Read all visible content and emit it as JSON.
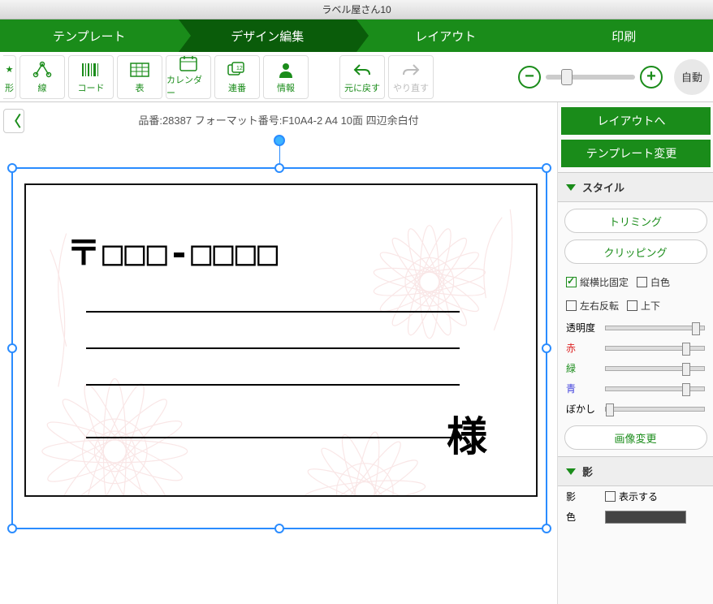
{
  "app_title": "ラベル屋さん10",
  "nav": {
    "tabs": [
      "テンプレート",
      "デザイン編集",
      "レイアウト",
      "印刷"
    ],
    "active_index": 1
  },
  "toolbar": {
    "items": [
      {
        "id": "shape",
        "label": "形",
        "icon": "star"
      },
      {
        "id": "line",
        "label": "線",
        "icon": "line"
      },
      {
        "id": "code",
        "label": "コード",
        "icon": "barcode"
      },
      {
        "id": "table",
        "label": "表",
        "icon": "table"
      },
      {
        "id": "calendar",
        "label": "カレンダー",
        "icon": "calendar"
      },
      {
        "id": "serial",
        "label": "連番",
        "icon": "serial"
      },
      {
        "id": "info",
        "label": "情報",
        "icon": "person"
      }
    ],
    "undo": "元に戻す",
    "redo": "やり直す",
    "auto": "自動"
  },
  "info_line": "品番:28387 フォーマット番号:F10A4-2 A4 10面 四辺余白付",
  "card": {
    "postal_template": "〒□□□-□□□□",
    "sama": "様"
  },
  "side": {
    "to_layout": "レイアウトへ",
    "change_template": "テンプレート変更",
    "style_header": "スタイル",
    "trimming": "トリミング",
    "clipping": "クリッピング",
    "aspect_lock": "縦横比固定",
    "whitening": "白色",
    "flip_h": "左右反転",
    "flip_v": "上下",
    "opacity": "透明度",
    "red": "赤",
    "green": "緑",
    "blue": "青",
    "blur": "ぼかし",
    "change_image": "画像変更",
    "shadow_header": "影",
    "shadow_label": "影",
    "show": "表示する",
    "color_label": "色"
  },
  "sliders": {
    "opacity": 100,
    "red": 85,
    "green": 85,
    "blue": 85,
    "blur": 0
  }
}
